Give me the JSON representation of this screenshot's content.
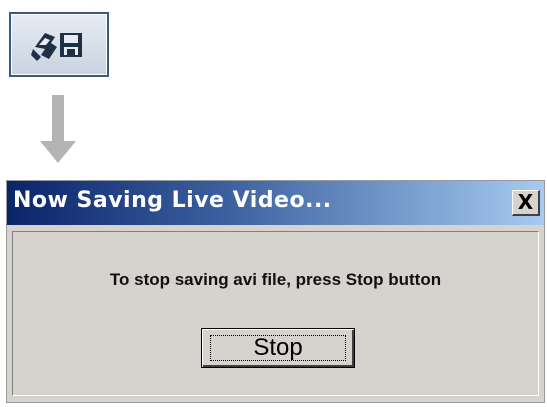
{
  "toolbar": {
    "save_video_button": {
      "icon": "save-video-icon"
    }
  },
  "flow_arrow": {
    "icon": "down-arrow-icon",
    "color": "#b4b4b4"
  },
  "dialog": {
    "title": "Now Saving Live Video...",
    "close_label": "X",
    "message": "To stop saving avi file, press Stop button",
    "stop_label": "Stop",
    "colors": {
      "title_bar_start": "#0a246a",
      "title_bar_end": "#a6caf0",
      "face": "#d6d3ce"
    }
  }
}
